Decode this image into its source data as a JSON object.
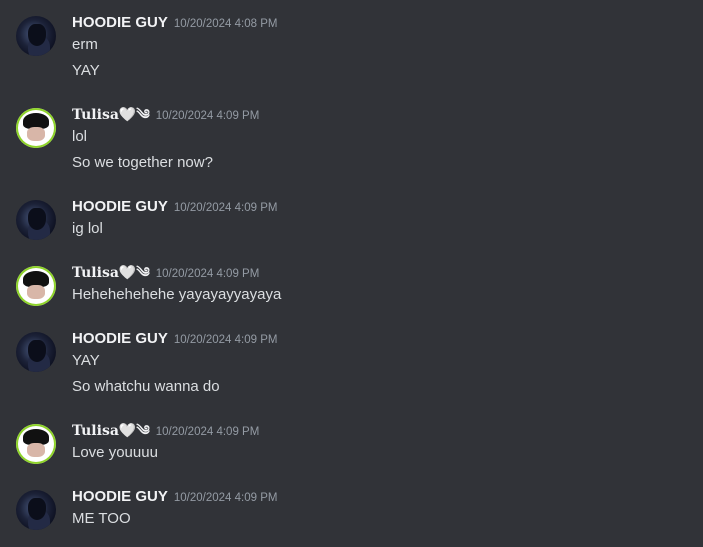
{
  "messages": [
    {
      "author": "HOODIE GUY",
      "avatar": "hoodie",
      "timestamp": "10/20/2024 4:08 PM",
      "lines": [
        "erm",
        "YAY"
      ]
    },
    {
      "author": "Tulisa🤍༄",
      "avatar": "tulisa",
      "timestamp": "10/20/2024 4:09 PM",
      "lines": [
        "lol",
        "So we together now?"
      ]
    },
    {
      "author": "HOODIE GUY",
      "avatar": "hoodie",
      "timestamp": "10/20/2024 4:09 PM",
      "lines": [
        "ig lol"
      ]
    },
    {
      "author": "Tulisa🤍༄",
      "avatar": "tulisa",
      "timestamp": "10/20/2024 4:09 PM",
      "lines": [
        "Hehehehehehe yayayayyayaya"
      ]
    },
    {
      "author": "HOODIE GUY",
      "avatar": "hoodie",
      "timestamp": "10/20/2024 4:09 PM",
      "lines": [
        "YAY",
        "So whatchu wanna do"
      ]
    },
    {
      "author": "Tulisa🤍༄",
      "avatar": "tulisa",
      "timestamp": "10/20/2024 4:09 PM",
      "lines": [
        "Love youuuu"
      ]
    },
    {
      "author": "HOODIE GUY",
      "avatar": "hoodie",
      "timestamp": "10/20/2024 4:09 PM",
      "lines": [
        "ME TOO"
      ]
    }
  ]
}
